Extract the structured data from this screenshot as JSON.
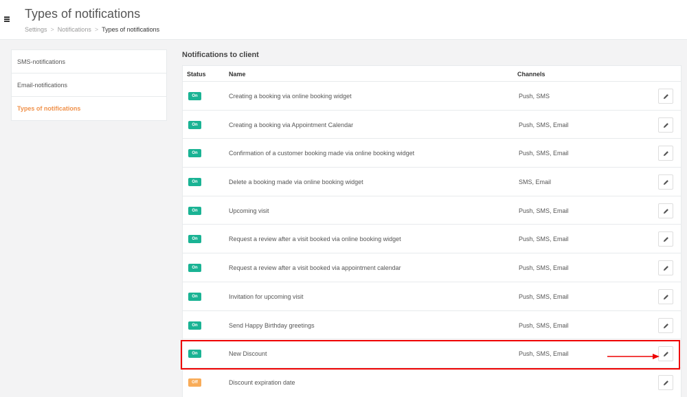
{
  "header": {
    "title": "Types of notifications",
    "menu_icon": "hamburger-icon",
    "breadcrumb": [
      "Settings",
      "Notifications",
      "Types of notifications"
    ],
    "breadcrumb_sep": ">"
  },
  "sidebar": {
    "items": [
      {
        "label": "SMS-notifications",
        "active": false
      },
      {
        "label": "Email-notifications",
        "active": false
      },
      {
        "label": "Types of notifications",
        "active": true
      }
    ]
  },
  "section": {
    "title": "Notifications to client"
  },
  "table": {
    "columns": {
      "status": "Status",
      "name": "Name",
      "channels": "Channels"
    },
    "rows": [
      {
        "status": "On",
        "name": "Creating a booking via online booking widget",
        "channels": "Push, SMS"
      },
      {
        "status": "On",
        "name": "Creating a booking via Appointment Calendar",
        "channels": "Push, SMS, Email"
      },
      {
        "status": "On",
        "name": "Confirmation of a customer booking made via online booking widget",
        "channels": "Push, SMS, Email"
      },
      {
        "status": "On",
        "name": "Delete a booking made via online booking widget",
        "channels": "SMS, Email"
      },
      {
        "status": "On",
        "name": "Upcoming visit",
        "channels": "Push, SMS, Email"
      },
      {
        "status": "On",
        "name": "Request a review after a visit booked via online booking widget",
        "channels": "Push, SMS, Email"
      },
      {
        "status": "On",
        "name": "Request a review after a visit booked via appointment calendar",
        "channels": "Push, SMS, Email"
      },
      {
        "status": "On",
        "name": "Invitation for upcoming visit",
        "channels": "Push, SMS, Email"
      },
      {
        "status": "On",
        "name": "Send Happy Birthday greetings",
        "channels": "Push, SMS, Email"
      },
      {
        "status": "On",
        "name": "New Discount",
        "channels": "Push, SMS, Email",
        "highlighted": true
      },
      {
        "status": "Off",
        "name": "Discount expiration date",
        "channels": ""
      }
    ],
    "edit_icon": "pencil-icon"
  },
  "colors": {
    "on": "#1ab394",
    "off": "#f8ac59",
    "active_link": "#f0914a",
    "highlight": "#e00000"
  }
}
